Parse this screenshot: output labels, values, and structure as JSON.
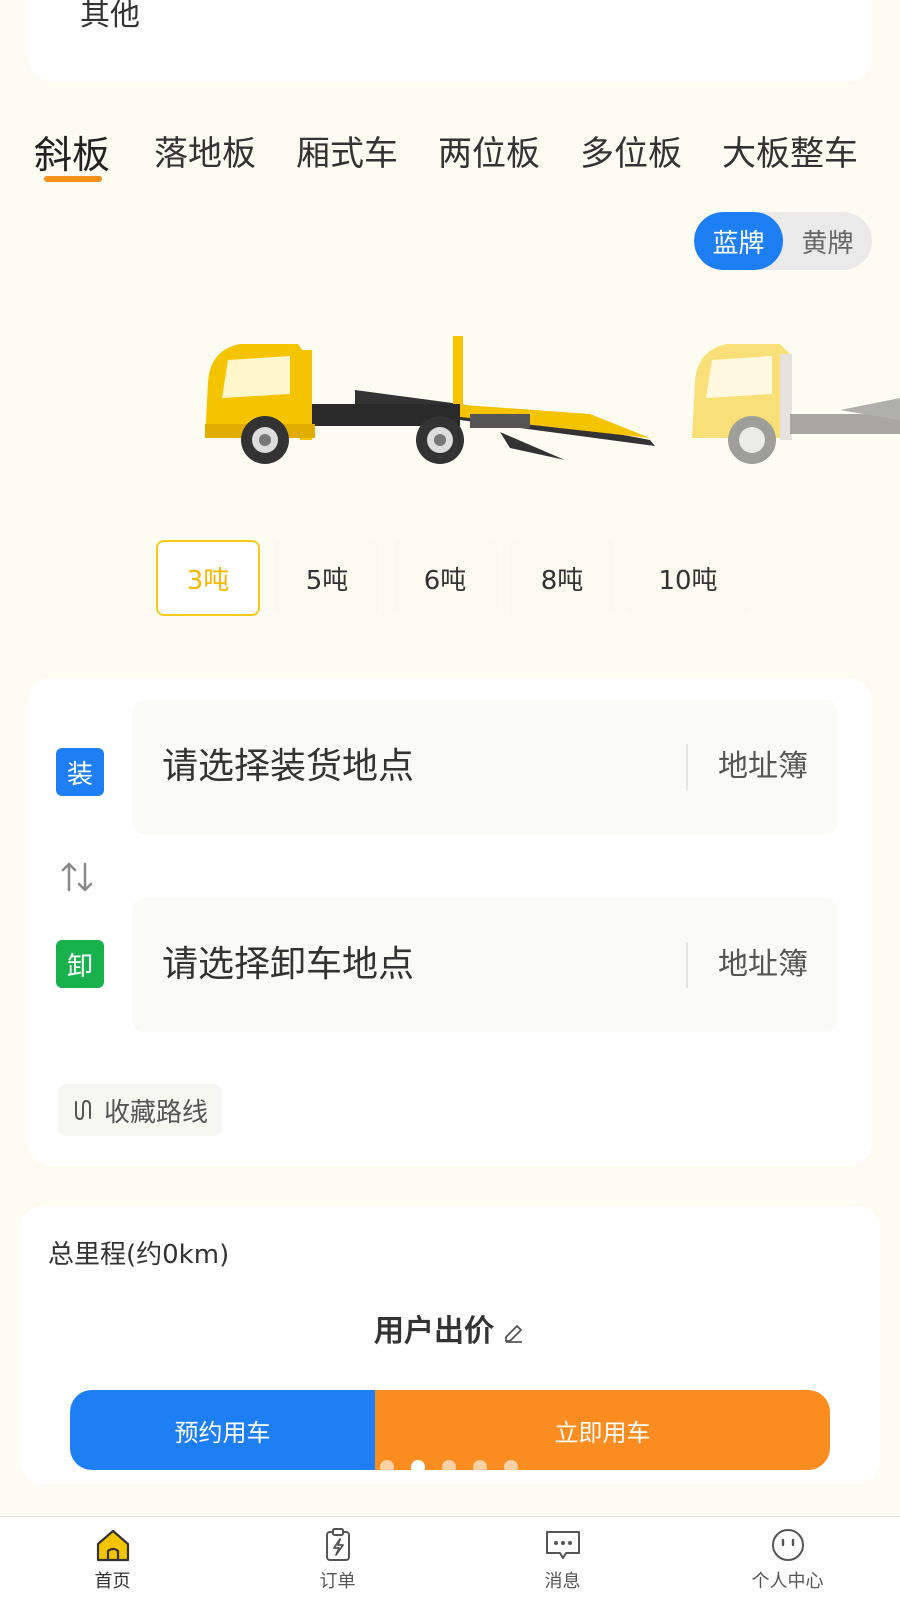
{
  "top_card": {
    "label": "其他"
  },
  "tabs": [
    {
      "label": "斜板",
      "active": true
    },
    {
      "label": "落地板",
      "active": false
    },
    {
      "label": "厢式车",
      "active": false
    },
    {
      "label": "两位板",
      "active": false
    },
    {
      "label": "多位板",
      "active": false
    },
    {
      "label": "大板整车",
      "active": false
    }
  ],
  "plate_toggle": {
    "blue": "蓝牌",
    "yellow": "黄牌",
    "selected": "蓝牌"
  },
  "tonnage": [
    {
      "label": "3吨",
      "active": true
    },
    {
      "label": "5吨",
      "active": false
    },
    {
      "label": "6吨",
      "active": false
    },
    {
      "label": "8吨",
      "active": false
    },
    {
      "label": "10吨",
      "active": false
    }
  ],
  "route": {
    "load_badge": "装",
    "load_placeholder": "请选择装货地点",
    "unload_badge": "卸",
    "unload_placeholder": "请选择卸车地点",
    "address_book": "地址簿",
    "favorite_route": "收藏路线"
  },
  "price": {
    "distance": "总里程(约0km)",
    "user_price": "用户出价",
    "reserve_button": "预约用车",
    "now_button": "立即用车"
  },
  "nav": [
    {
      "label": "首页",
      "icon": "home-icon",
      "active": true
    },
    {
      "label": "订单",
      "icon": "order-icon",
      "active": false
    },
    {
      "label": "消息",
      "icon": "message-icon",
      "active": false
    },
    {
      "label": "个人中心",
      "icon": "profile-icon",
      "active": false
    }
  ],
  "colors": {
    "accent_blue": "#1e7ff5",
    "accent_orange": "#fb8c1f",
    "accent_yellow": "#f5cc1a",
    "tab_underline": "#f39019",
    "unload_green": "#17b24e"
  }
}
